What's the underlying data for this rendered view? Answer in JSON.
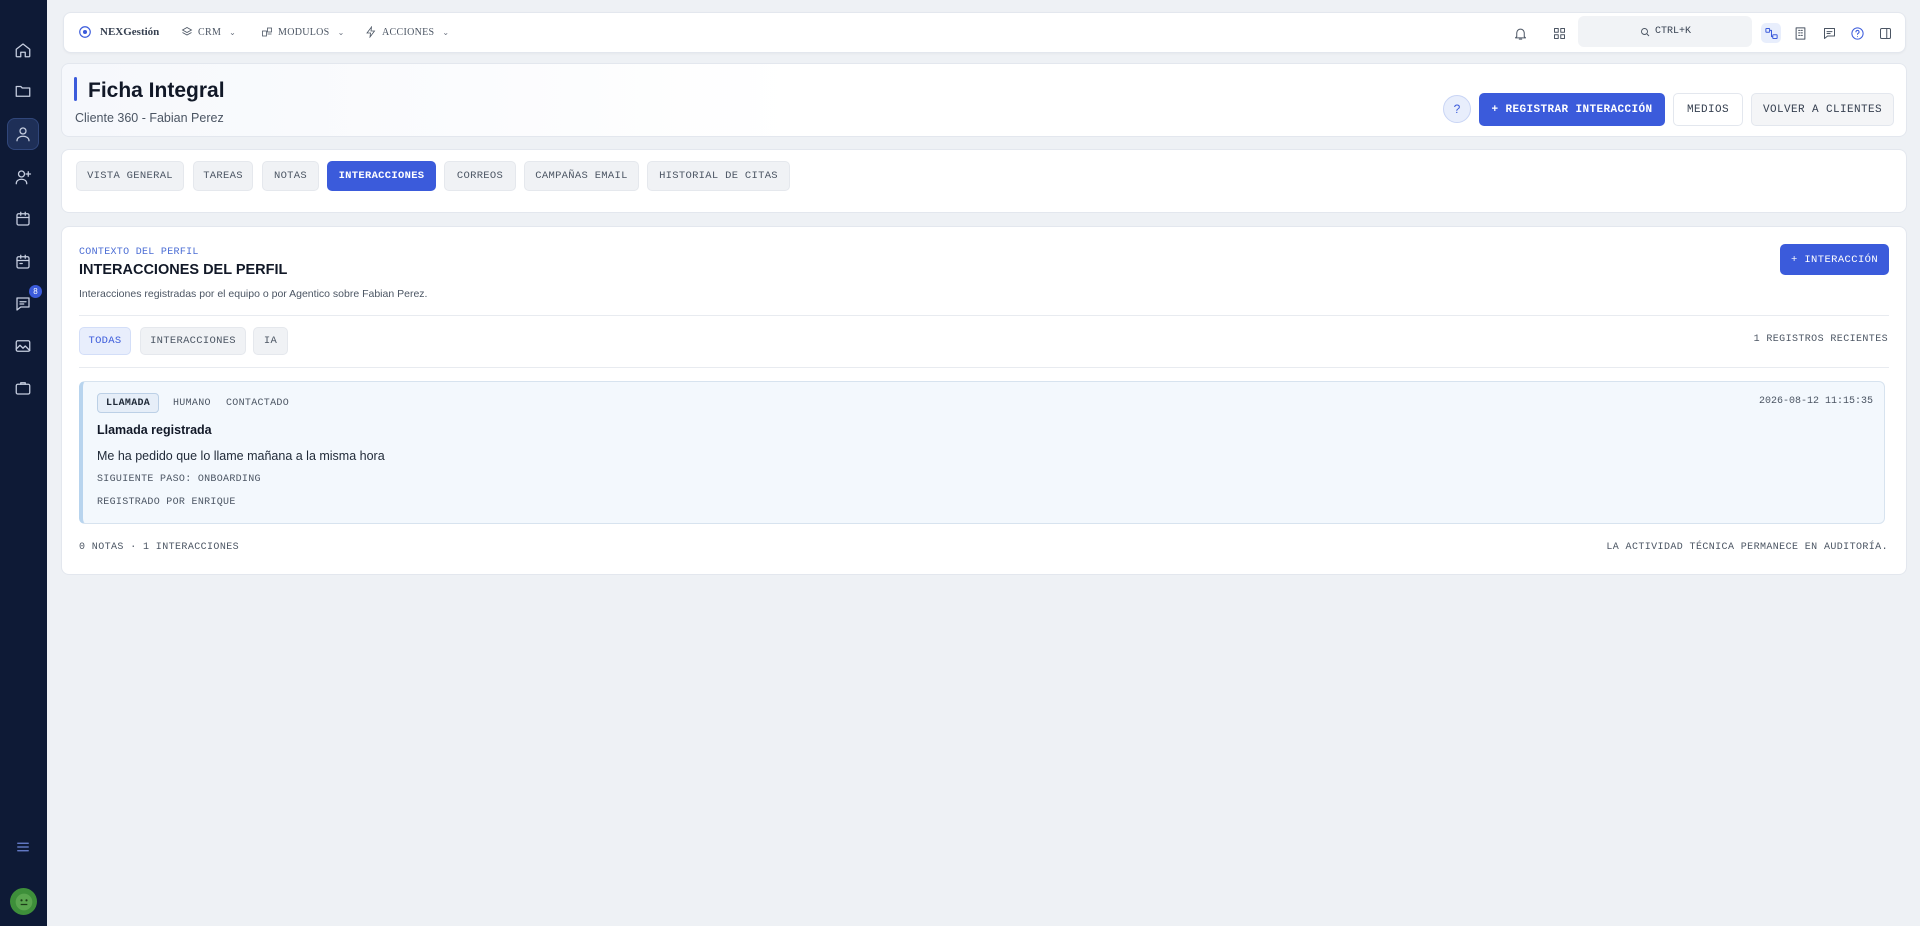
{
  "sidebar": {
    "items": [
      {
        "icon": "home-icon"
      },
      {
        "icon": "folder-icon"
      },
      {
        "icon": "user-icon",
        "active": true
      },
      {
        "icon": "user-plus-icon"
      },
      {
        "icon": "calendar-icon"
      },
      {
        "icon": "calendar-alt-icon"
      },
      {
        "icon": "chat-icon",
        "badge": "8"
      },
      {
        "icon": "image-icon"
      },
      {
        "icon": "briefcase-icon"
      }
    ],
    "badge": "8",
    "menu_icon": "hamburger-icon"
  },
  "topbar": {
    "brand": "NEXGestión",
    "menus": [
      "CRM",
      "MODULOS",
      "ACCIONES"
    ],
    "search_shortcut": "CTRL+K"
  },
  "header": {
    "title": "Ficha Integral",
    "subtitle": "Cliente 360 - Fabian Perez",
    "help": "?",
    "register_btn": "+ REGISTRAR INTERACCIÓN",
    "media_btn": "MEDIOS",
    "back_btn": "VOLVER A CLIENTES"
  },
  "tabs": [
    "VISTA GENERAL",
    "TAREAS",
    "NOTAS",
    "INTERACCIONES",
    "CORREOS",
    "CAMPAÑAS EMAIL",
    "HISTORIAL DE CITAS"
  ],
  "active_tab": "INTERACCIONES",
  "section": {
    "eyebrow": "CONTEXTO DEL PERFIL",
    "title": "INTERACCIONES DEL PERFIL",
    "description": "Interacciones registradas por el equipo o por Agentico sobre Fabian Perez.",
    "add_btn": "+ INTERACCIÓN",
    "filters": [
      "TODAS",
      "INTERACCIONES",
      "IA"
    ],
    "recent_count": "1 REGISTROS RECIENTES"
  },
  "entry": {
    "type": "LLAMADA",
    "origin": "HUMANO",
    "status": "CONTACTADO",
    "date": "2026-08-12 11:15:35",
    "title": "Llamada registrada",
    "body": "Me ha pedido que lo llame mañana a la misma hora",
    "next_step": "SIGUIENTE PASO: ONBOARDING",
    "registered_by": "REGISTRADO POR ENRIQUE"
  },
  "footer": {
    "counts": "0 NOTAS · 1 INTERACCIONES",
    "audit": "LA ACTIVIDAD TÉCNICA PERMANECE EN AUDITORÍA."
  },
  "colors": {
    "sidebar_bg": "#0e1a36",
    "accent": "#3b5bdb",
    "page_bg": "#eef1f5"
  }
}
